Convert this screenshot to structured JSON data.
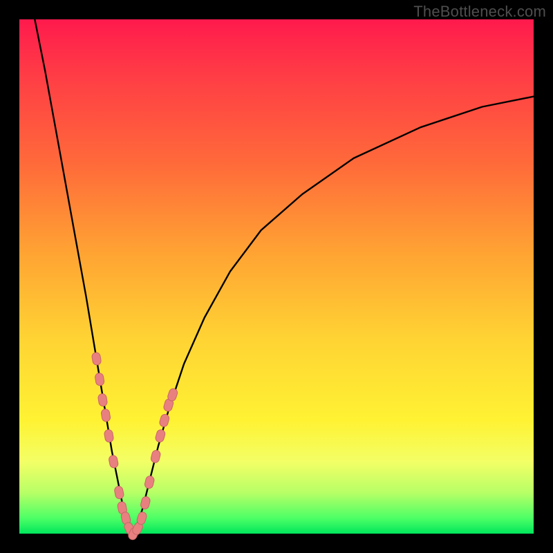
{
  "watermark": "TheBottleneck.com",
  "colors": {
    "frame": "#000000",
    "curve": "#000000",
    "marker_fill": "#e98080",
    "marker_stroke": "#c76666",
    "gradient_stops": [
      "#ff1a4d",
      "#ff6a3a",
      "#ffd333",
      "#fff233",
      "#4dff66",
      "#00e65c"
    ]
  },
  "chart_data": {
    "type": "line",
    "title": "",
    "xlabel": "",
    "ylabel": "",
    "xlim": [
      0,
      100
    ],
    "ylim": [
      0,
      100
    ],
    "grid": false,
    "note": "Two convex curves descending to a common minimum near x≈22; left branch steep, right branch shallow. Y appears to represent a bottleneck/mismatch percentage where 0 (bottom, green) is ideal and 100 (top, red) is worst. Values estimated from pixel positions.",
    "series": [
      {
        "name": "left-branch",
        "x": [
          3,
          5,
          7,
          9,
          11,
          13,
          15,
          16,
          17,
          18,
          19,
          20,
          21,
          22
        ],
        "y": [
          100,
          90,
          79,
          68,
          57,
          46,
          34,
          28,
          22,
          16,
          11,
          6,
          2,
          0
        ]
      },
      {
        "name": "right-branch",
        "x": [
          22,
          23,
          24,
          25,
          26,
          27,
          29,
          32,
          36,
          41,
          47,
          55,
          65,
          78,
          90,
          100
        ],
        "y": [
          0,
          2,
          5,
          9,
          13,
          17,
          24,
          33,
          42,
          51,
          59,
          66,
          73,
          79,
          83,
          85
        ]
      }
    ],
    "markers": {
      "name": "highlighted-points",
      "note": "Pink capsule/round markers clustered along both branches in the lower ~30% of the chart, near and around the minimum.",
      "points": [
        {
          "x": 15.0,
          "y": 34
        },
        {
          "x": 15.6,
          "y": 30
        },
        {
          "x": 16.2,
          "y": 26
        },
        {
          "x": 16.8,
          "y": 23
        },
        {
          "x": 17.4,
          "y": 19
        },
        {
          "x": 18.3,
          "y": 14
        },
        {
          "x": 19.4,
          "y": 8
        },
        {
          "x": 20.0,
          "y": 5
        },
        {
          "x": 20.7,
          "y": 3
        },
        {
          "x": 21.4,
          "y": 1
        },
        {
          "x": 22.2,
          "y": 0
        },
        {
          "x": 23.0,
          "y": 1
        },
        {
          "x": 23.8,
          "y": 3
        },
        {
          "x": 24.5,
          "y": 6
        },
        {
          "x": 25.3,
          "y": 10
        },
        {
          "x": 26.5,
          "y": 15
        },
        {
          "x": 27.4,
          "y": 19
        },
        {
          "x": 28.2,
          "y": 22
        },
        {
          "x": 29.0,
          "y": 25
        },
        {
          "x": 29.8,
          "y": 27
        }
      ]
    }
  }
}
